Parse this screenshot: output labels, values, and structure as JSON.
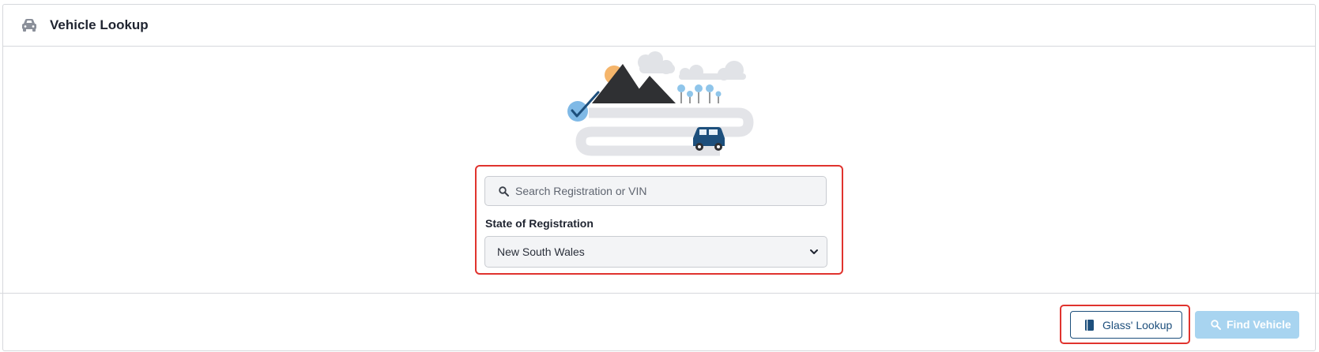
{
  "header": {
    "title": "Vehicle Lookup",
    "icon": "car-icon"
  },
  "search": {
    "placeholder": "Search Registration or VIN",
    "value": "",
    "icon": "search-icon"
  },
  "state": {
    "label": "State of Registration",
    "selected": "New South Wales",
    "icon": "chevron-down-icon"
  },
  "illustration": {
    "name": "vehicle-lookup-illustration"
  },
  "footer": {
    "glass_label": "Glass' Lookup",
    "glass_icon": "book-icon",
    "find_label": "Find Vehicle",
    "find_icon": "search-icon"
  },
  "colors": {
    "accent": "#1d4f7c",
    "disabled_button": "#a8d4f0",
    "highlight": "#e0332e",
    "field_bg": "#f3f4f6"
  }
}
